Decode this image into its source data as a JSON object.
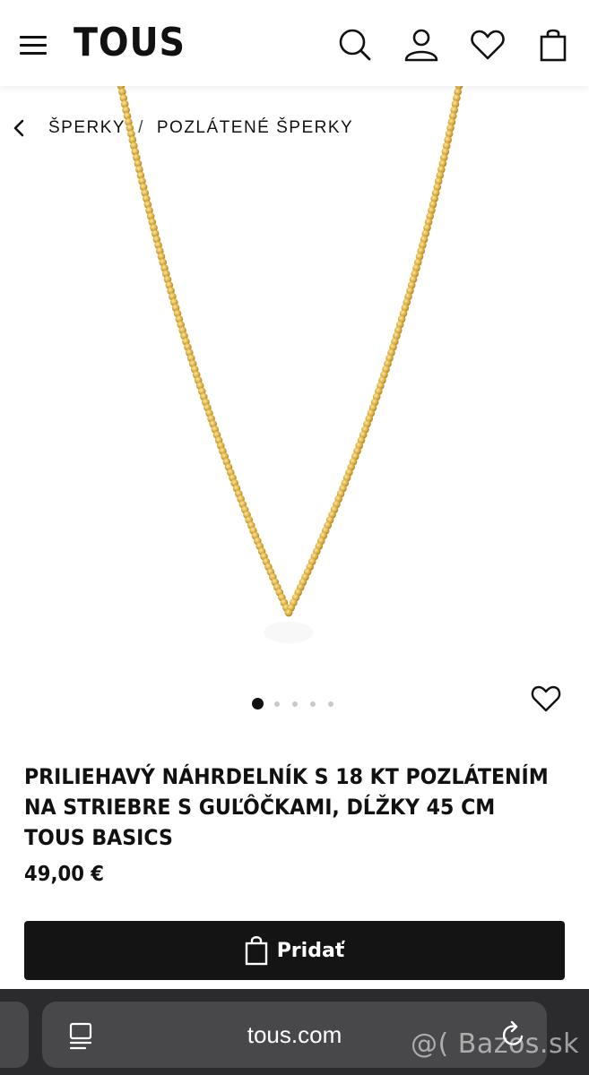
{
  "header": {
    "logo": "TOUS",
    "icons": [
      "menu-icon",
      "search-icon",
      "user-icon",
      "heart-icon",
      "shopping-bag-icon"
    ]
  },
  "breadcrumb": {
    "items": [
      "ŠPERKY",
      "POZLÁTENÉ ŠPERKY"
    ],
    "separator": "/"
  },
  "gallery": {
    "image_count": 5,
    "active_index": 0
  },
  "product": {
    "title_lines": [
      "PRILIEHAVÝ NÁHRDELNÍK S 18 KT POZLÁTENÍM",
      "NA STRIEBRE S GUĽÔČKAMI, DĹŽKY 45 CM",
      "TOUS BASICS"
    ],
    "price": "49,00 €",
    "add_button_label": "Pridať"
  },
  "browser": {
    "url": "tous.com"
  },
  "watermark": "@( Bazos.sk",
  "colors": {
    "button_bg": "#141414",
    "chain_gold": "#e2b84a",
    "browser_bar": "#2b2b2d"
  }
}
